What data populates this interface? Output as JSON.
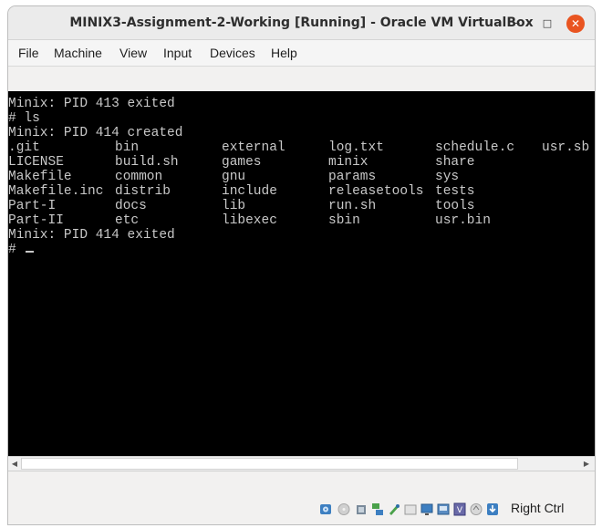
{
  "window": {
    "title": "MINIX3-Assignment-2-Working [Running] - Oracle VM VirtualBox"
  },
  "titlebar_buttons": {
    "minimize": "–",
    "maximize": "□",
    "close": "✕"
  },
  "menu": [
    "File",
    "Machine",
    "View",
    "Input",
    "Devices",
    "Help"
  ],
  "terminal": {
    "lines": [
      "Minix: PID 413 exited",
      "# ls",
      "Minix: PID 414 created"
    ],
    "ls_rows": [
      [
        ".git",
        "bin",
        "external",
        "log.txt",
        "schedule.c",
        "usr.sb"
      ],
      [
        "LICENSE",
        "build.sh",
        "games",
        "minix",
        "share",
        ""
      ],
      [
        "Makefile",
        "common",
        "gnu",
        "params",
        "sys",
        ""
      ],
      [
        "Makefile.inc",
        "distrib",
        "include",
        "releasetools",
        "tests",
        ""
      ],
      [
        "Part-I",
        "docs",
        "lib",
        "run.sh",
        "tools",
        ""
      ],
      [
        "Part-II",
        "etc",
        "libexec",
        "sbin",
        "usr.bin",
        ""
      ]
    ],
    "after": [
      "Minix: PID 414 exited"
    ],
    "prompt": "#"
  },
  "scrollbar": {
    "left_arrow": "◀",
    "right_arrow": "▶"
  },
  "status": {
    "host_key": "Right Ctrl",
    "icons": [
      "hard-disk-icon",
      "optical-drive-icon",
      "audio-icon",
      "network-icon",
      "usb-icon",
      "shared-folders-icon",
      "display-icon",
      "recording-icon",
      "virtualization-icon",
      "mouse-integration-icon",
      "keyboard-capture-icon"
    ]
  }
}
